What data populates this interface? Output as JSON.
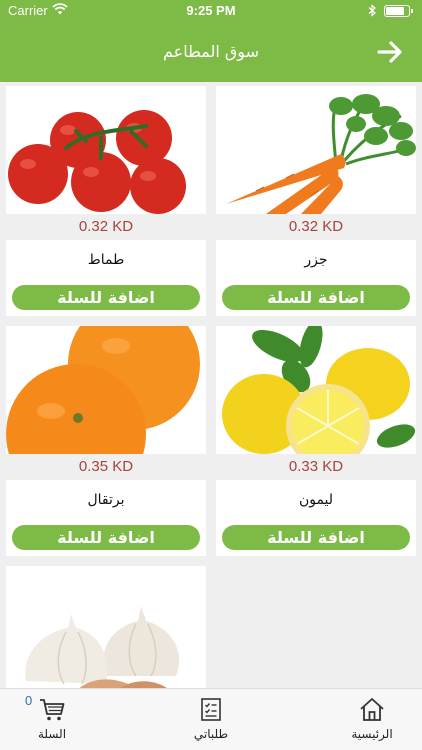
{
  "status_bar": {
    "carrier": "Carrier",
    "time": "9:25 PM"
  },
  "header": {
    "title": "سوق المطاعم",
    "back_icon": "arrow-right-icon"
  },
  "colors": {
    "brand_green": "#7dbb46",
    "price_red": "#a8433f"
  },
  "products": [
    {
      "name": "جزر",
      "price": "0.32 KD",
      "add_label": "اضافة للسلة",
      "image": "carrot"
    },
    {
      "name": "طماط",
      "price": "0.32 KD",
      "add_label": "اضافة للسلة",
      "image": "tomato"
    },
    {
      "name": "ليمون",
      "price": "0.33 KD",
      "add_label": "اضافة للسلة",
      "image": "lemon"
    },
    {
      "name": "برتقال",
      "price": "0.35 KD",
      "add_label": "اضافة للسلة",
      "image": "orange"
    },
    {
      "image": "garlic"
    }
  ],
  "tabbar": {
    "home_label": "الرئيسية",
    "orders_label": "طلباتي",
    "cart_label": "السلة",
    "cart_count": "0"
  }
}
